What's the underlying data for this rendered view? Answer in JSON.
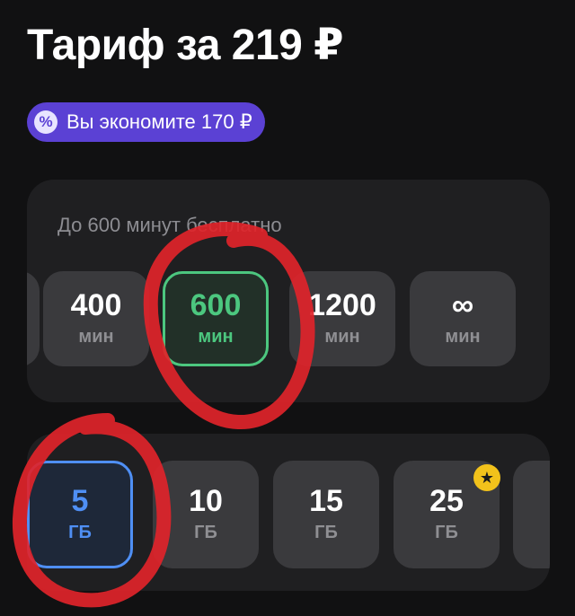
{
  "tariff": {
    "title": "Тариф за 219 ₽",
    "savings_badge": {
      "icon": "percent-icon",
      "icon_glyph": "%",
      "text": "Вы экономите 170 ₽"
    }
  },
  "minutes_panel": {
    "label": "До 600 минут бесплатно",
    "options": [
      {
        "value": "",
        "unit": "",
        "selected": false
      },
      {
        "value": "400",
        "unit": "мин",
        "selected": false
      },
      {
        "value": "600",
        "unit": "мин",
        "selected": true
      },
      {
        "value": "1200",
        "unit": "мин",
        "selected": false
      },
      {
        "value": "∞",
        "unit": "мин",
        "selected": false
      }
    ]
  },
  "data_panel": {
    "options": [
      {
        "value": "5",
        "unit": "ГБ",
        "selected": true
      },
      {
        "value": "10",
        "unit": "ГБ",
        "selected": false
      },
      {
        "value": "15",
        "unit": "ГБ",
        "selected": false
      },
      {
        "value": "25",
        "unit": "ГБ",
        "selected": false,
        "badge": "star-icon",
        "badge_glyph": "★"
      },
      {
        "value": "",
        "unit": "",
        "selected": false
      }
    ]
  },
  "colors": {
    "background": "#111112",
    "panel": "#1f1f21",
    "option": "#3a3a3d",
    "badge": "#5b41d4",
    "selected_minutes": "#4cc77f",
    "selected_data": "#4f8ff4",
    "star": "#f2c21b",
    "annotation_circle": "#e0242a"
  }
}
